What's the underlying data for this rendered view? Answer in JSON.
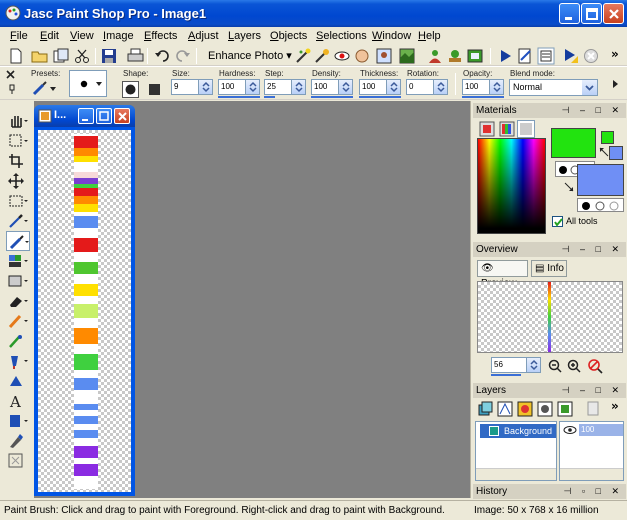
{
  "window": {
    "title": "Jasc Paint Shop Pro - Image1",
    "buttons": [
      "minimize-icon",
      "maximize-icon",
      "close-icon"
    ]
  },
  "menu": [
    "File",
    "Edit",
    "View",
    "Image",
    "Effects",
    "Adjust",
    "Layers",
    "Objects",
    "Selections",
    "Window",
    "Help"
  ],
  "toolbar": {
    "enhance_photo": "Enhance Photo",
    "overflow": "»"
  },
  "tool_options": {
    "presets_label": "Presets:",
    "shape_label": "Shape:",
    "size_label": "Size:",
    "size_value": "9",
    "hardness_label": "Hardness:",
    "hardness_value": "100",
    "step_label": "Step:",
    "step_value": "25",
    "density_label": "Density:",
    "density_value": "100",
    "thickness_label": "Thickness:",
    "thickness_value": "100",
    "rotation_label": "Rotation:",
    "rotation_value": "0",
    "opacity_label": "Opacity:",
    "opacity_value": "100",
    "blend_label": "Blend mode:",
    "blend_value": "Normal"
  },
  "image_window": {
    "title": "I..."
  },
  "panels": {
    "materials": {
      "title": "Materials",
      "all_tools_label": "All tools",
      "all_tools_checked": true,
      "foreground_color": "#22e30f",
      "background_color": "#6f8ff5"
    },
    "overview": {
      "title": "Overview",
      "tab_preview": "Preview",
      "tab_info": "Info",
      "zoom_value": "56"
    },
    "layers": {
      "title": "Layers",
      "layer_name": "Background",
      "layer_opacity": "100"
    },
    "history": {
      "title": "History"
    }
  },
  "status": {
    "hint": "Paint Brush: Click and drag to paint with Foreground. Right-click and drag to paint with Background.",
    "image_info": "Image:  50 x 768 x 16 million"
  },
  "colors": {
    "title_bar": "#0047d0",
    "workspace": "#808080",
    "accent": "#3b6fd6"
  }
}
